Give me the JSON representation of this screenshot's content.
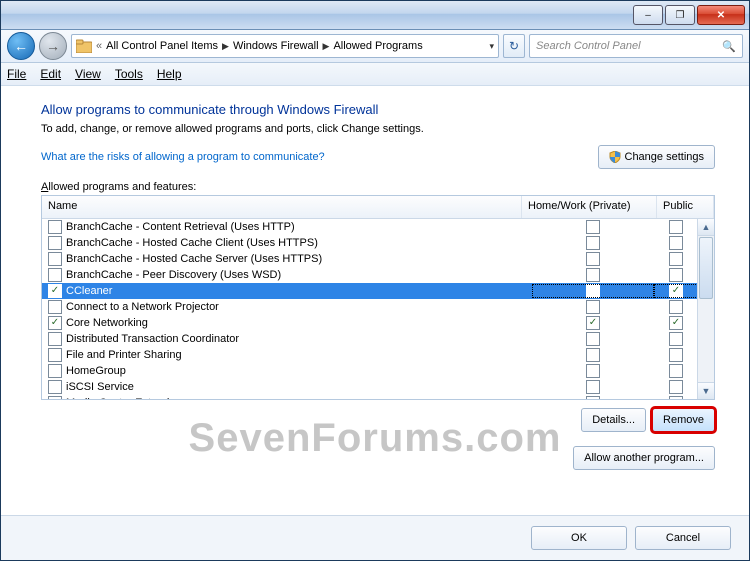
{
  "titlebar": {
    "minimize": "–",
    "maximize": "❐",
    "close": "✕"
  },
  "nav": {
    "back": "←",
    "forward": "→",
    "crumb_prefix": "«",
    "crumb1": "All Control Panel Items",
    "crumb2": "Windows Firewall",
    "crumb3": "Allowed Programs",
    "refresh": "↻",
    "search_placeholder": "Search Control Panel"
  },
  "menu": {
    "file": "File",
    "edit": "Edit",
    "view": "View",
    "tools": "Tools",
    "help": "Help"
  },
  "main": {
    "heading": "Allow programs to communicate through Windows Firewall",
    "subtext": "To add, change, or remove allowed programs and ports, click Change settings.",
    "risk_link": "What are the risks of allowing a program to communicate?",
    "change_settings": "Change settings",
    "group_label": "Allowed programs and features:",
    "columns": {
      "name": "Name",
      "home": "Home/Work (Private)",
      "public": "Public"
    },
    "rows": [
      {
        "name": "BranchCache - Content Retrieval (Uses HTTP)",
        "enabled": false,
        "home": false,
        "public": false,
        "selected": false
      },
      {
        "name": "BranchCache - Hosted Cache Client (Uses HTTPS)",
        "enabled": false,
        "home": false,
        "public": false,
        "selected": false
      },
      {
        "name": "BranchCache - Hosted Cache Server (Uses HTTPS)",
        "enabled": false,
        "home": false,
        "public": false,
        "selected": false
      },
      {
        "name": "BranchCache - Peer Discovery (Uses WSD)",
        "enabled": false,
        "home": false,
        "public": false,
        "selected": false
      },
      {
        "name": "CCleaner",
        "enabled": true,
        "home": false,
        "public": true,
        "selected": true
      },
      {
        "name": "Connect to a Network Projector",
        "enabled": false,
        "home": false,
        "public": false,
        "selected": false
      },
      {
        "name": "Core Networking",
        "enabled": true,
        "home": true,
        "public": true,
        "selected": false
      },
      {
        "name": "Distributed Transaction Coordinator",
        "enabled": false,
        "home": false,
        "public": false,
        "selected": false
      },
      {
        "name": "File and Printer Sharing",
        "enabled": false,
        "home": false,
        "public": false,
        "selected": false
      },
      {
        "name": "HomeGroup",
        "enabled": false,
        "home": false,
        "public": false,
        "selected": false
      },
      {
        "name": "iSCSI Service",
        "enabled": false,
        "home": false,
        "public": false,
        "selected": false
      },
      {
        "name": "Media Center Extenders",
        "enabled": false,
        "home": false,
        "public": false,
        "selected": false
      }
    ],
    "details": "Details...",
    "remove": "Remove",
    "allow_another": "Allow another program...",
    "watermark": "SevenForums.com"
  },
  "footer": {
    "ok": "OK",
    "cancel": "Cancel"
  }
}
